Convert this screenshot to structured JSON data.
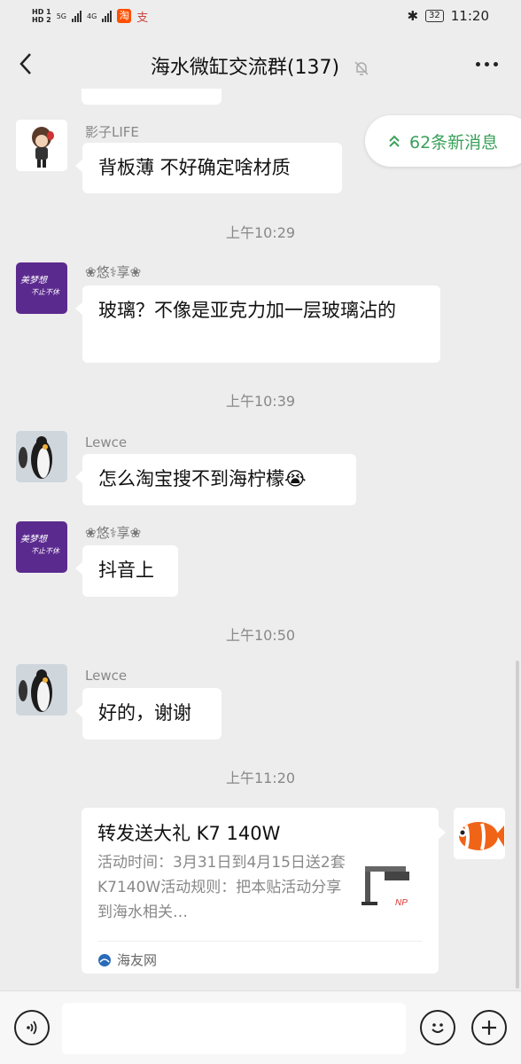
{
  "status_bar": {
    "hd1": "HD 1",
    "hd2": "HD 2",
    "net1": "5G",
    "net2": "4G",
    "taobao": "淘",
    "alipay": "支",
    "battery": "32",
    "time": "11:20"
  },
  "header": {
    "title": "海水微缸交流群(137)"
  },
  "new_messages": {
    "label": "62条新消息"
  },
  "messages": [
    {
      "sender": "影子LIFE",
      "text": "背板薄  不好确定啥材质"
    },
    {
      "time": "上午10:29"
    },
    {
      "sender": "❀悠⚕享❀",
      "text": "玻璃？不像是亚克力加一层玻璃沾的"
    },
    {
      "time": "上午10:39"
    },
    {
      "sender": "Lewce",
      "text": "怎么淘宝搜不到海柠檬😭"
    },
    {
      "sender": "❀悠⚕享❀",
      "text": "抖音上"
    },
    {
      "time": "上午10:50"
    },
    {
      "sender": "Lewce",
      "text": "好的，谢谢"
    },
    {
      "time": "上午11:20"
    }
  ],
  "avatar_text": {
    "line1": "美梦想",
    "line2": "不止不休"
  },
  "card": {
    "title": "转发送大礼 K7 140W",
    "desc": "活动时间：3月31日到4月15日送2套K7140W活动规则：把本贴活动分享到海水相关…",
    "source": "海友网",
    "thumb_brand": "NP"
  },
  "colors": {
    "accent_green": "#3aa05a",
    "background": "#ededed"
  }
}
